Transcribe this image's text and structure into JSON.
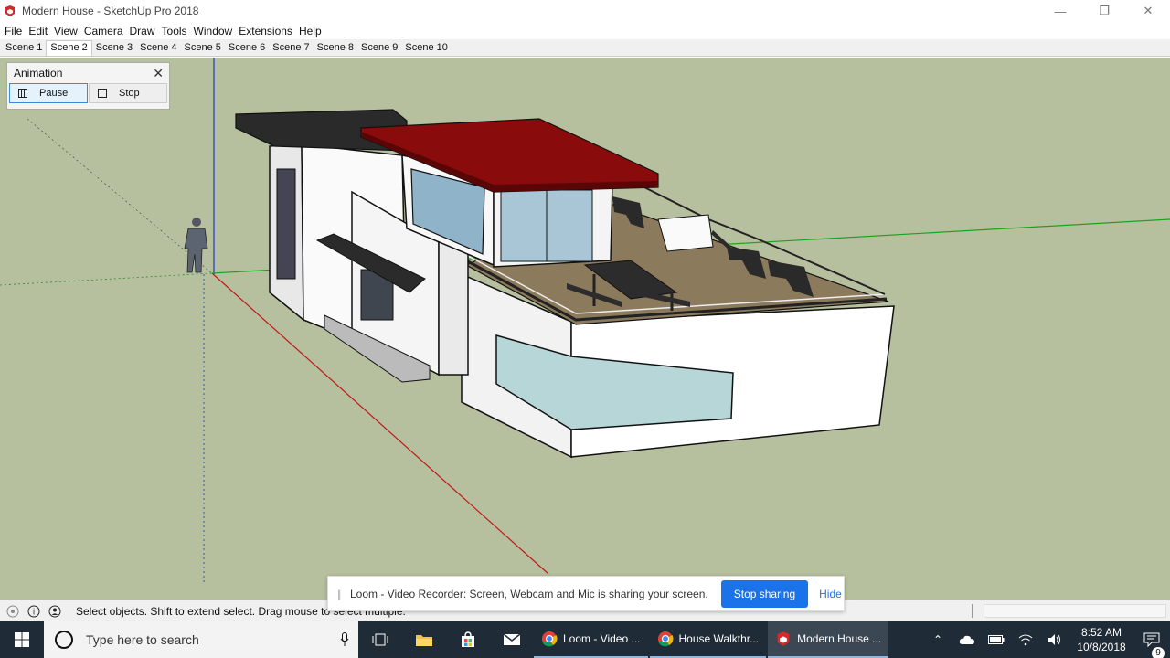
{
  "window": {
    "title": "Modern House - SketchUp Pro 2018"
  },
  "menu": {
    "items": [
      "File",
      "Edit",
      "View",
      "Camera",
      "Draw",
      "Tools",
      "Window",
      "Extensions",
      "Help"
    ]
  },
  "scenes": {
    "tabs": [
      "Scene 1",
      "Scene 2",
      "Scene 3",
      "Scene 4",
      "Scene 5",
      "Scene 6",
      "Scene 7",
      "Scene 8",
      "Scene 9",
      "Scene 10"
    ],
    "active": "Scene 2"
  },
  "animation_dialog": {
    "title": "Animation",
    "pause_label": "Pause",
    "stop_label": "Stop"
  },
  "status": {
    "message": "Select objects. Shift to extend select. Drag mouse to select multiple."
  },
  "loom": {
    "message": "Loom - Video Recorder: Screen, Webcam and Mic is sharing your screen.",
    "stop_label": "Stop sharing",
    "hide_label": "Hide"
  },
  "taskbar": {
    "search_placeholder": "Type here to search",
    "apps": [
      "Loom - Video ...",
      "House Walkthr...",
      "Modern House ..."
    ],
    "time": "8:52 AM",
    "date": "10/8/2018",
    "notification_count": "9"
  },
  "colors": {
    "viewport_bg": "#b6c09e",
    "roof_red": "#8a0b0b",
    "accent_blue": "#1a73e8",
    "taskbar_bg": "#1f2b36"
  }
}
